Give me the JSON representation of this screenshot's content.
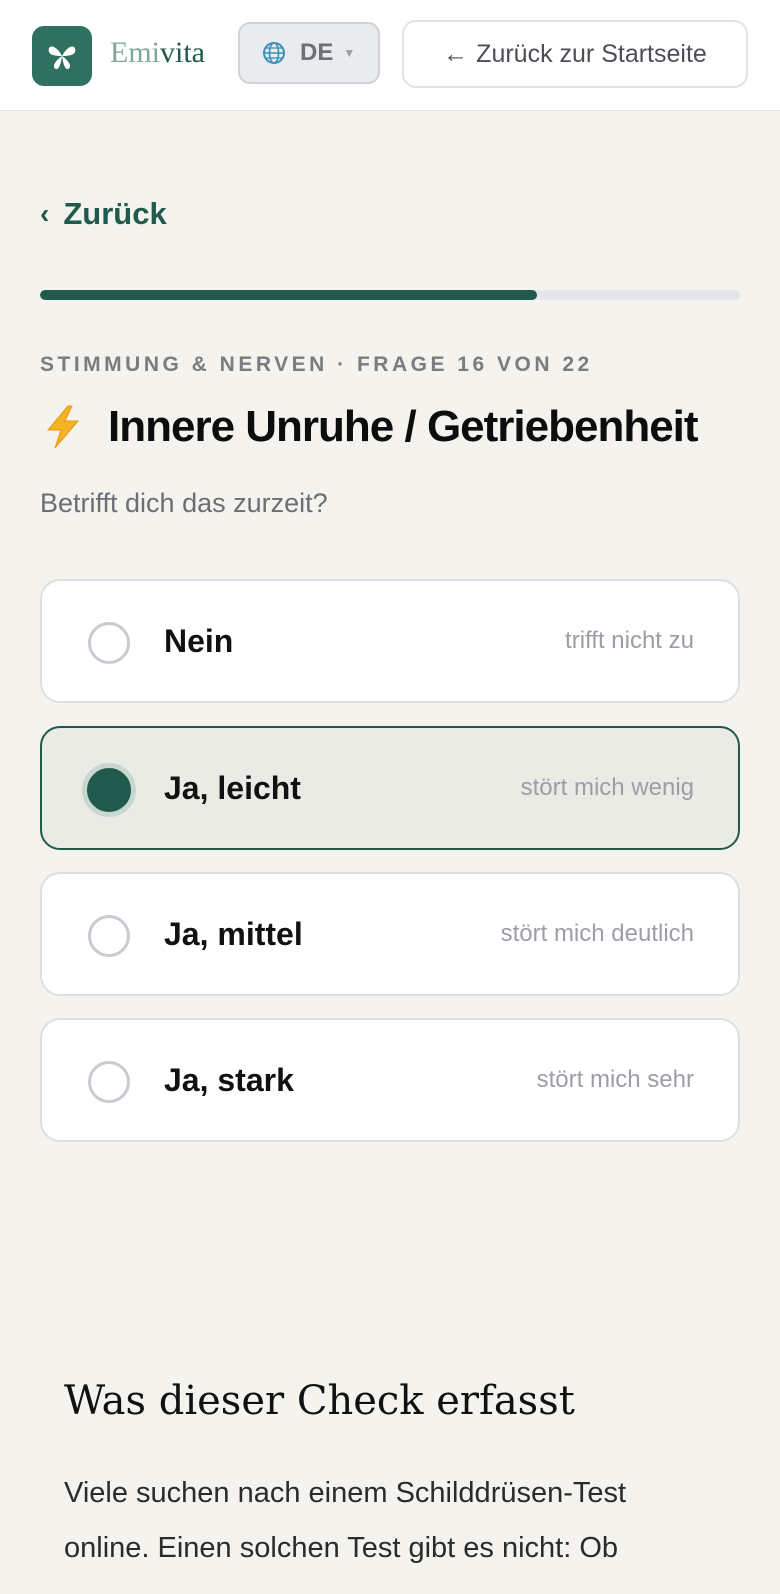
{
  "header": {
    "brand_prefix": "Emi",
    "brand_suffix": "vita",
    "language": "DE",
    "back_home": "Zurück zur Startseite",
    "brand_color": "#2f7060"
  },
  "nav": {
    "back_label": "Zurück"
  },
  "progress": {
    "value_percent": 71
  },
  "question": {
    "eyebrow": "STIMMUNG & NERVEN · FRAGE 16 VON 22",
    "icon": "lightning-bolt-icon",
    "title": "Innere Unruhe / Getriebenheit",
    "subtitle": "Betrifft dich das zurzeit?"
  },
  "options": [
    {
      "label": "Nein",
      "description": "trifft nicht zu",
      "selected": false
    },
    {
      "label": "Ja, leicht",
      "description": "stört mich wenig",
      "selected": true
    },
    {
      "label": "Ja, mittel",
      "description": "stört mich deutlich",
      "selected": false
    },
    {
      "label": "Ja, stark",
      "description": "stört mich sehr",
      "selected": false
    }
  ],
  "info": {
    "title": "Was dieser Check erfasst",
    "body": "Viele suchen nach einem Schilddrüsen-Test online. Einen solchen Test gibt es nicht: Ob"
  },
  "colors": {
    "accent": "#1f5a4c",
    "background": "#f5f3ee"
  }
}
